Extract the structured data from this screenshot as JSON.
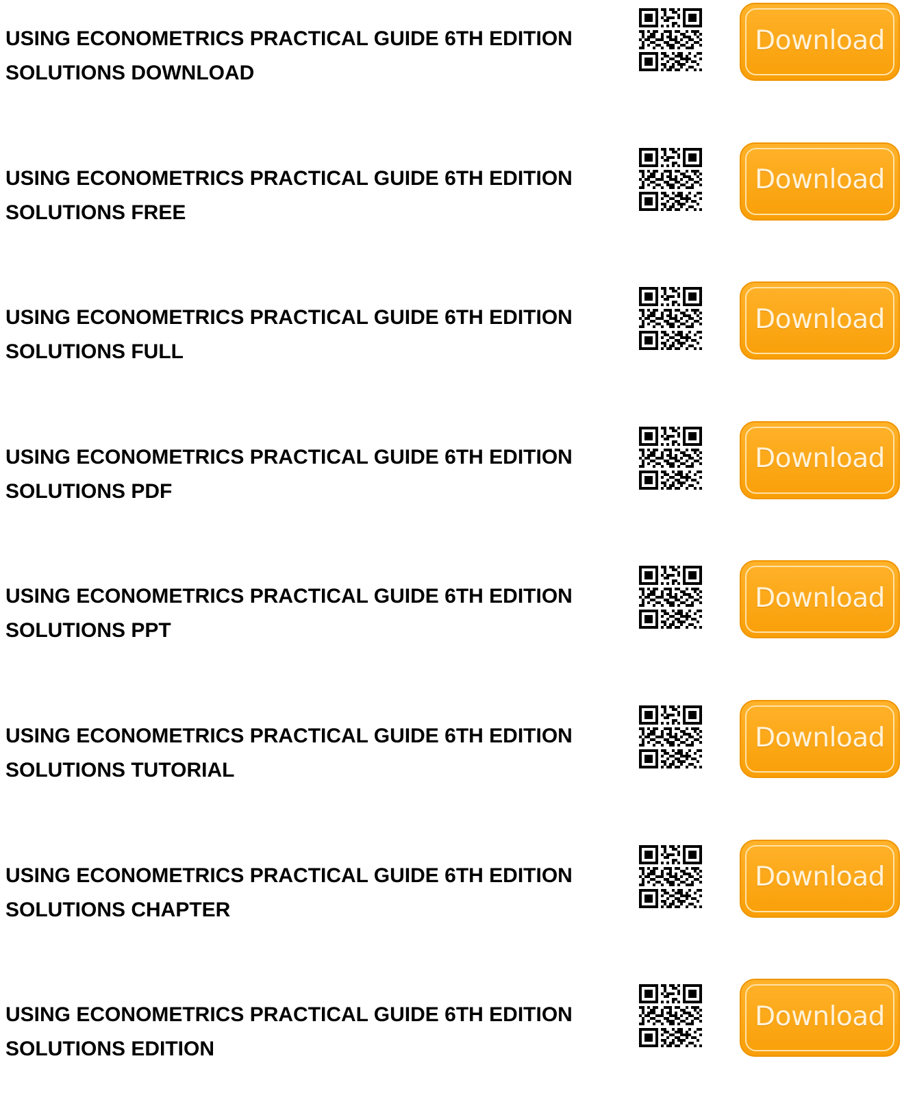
{
  "entries": [
    {
      "line1": "USING ECONOMETRICS PRACTICAL GUIDE 6TH EDITION",
      "line2": "SOLUTIONS DOWNLOAD"
    },
    {
      "line1": "USING ECONOMETRICS PRACTICAL GUIDE 6TH EDITION",
      "line2": "SOLUTIONS FREE"
    },
    {
      "line1": "USING ECONOMETRICS PRACTICAL GUIDE 6TH EDITION",
      "line2": "SOLUTIONS FULL"
    },
    {
      "line1": "USING ECONOMETRICS PRACTICAL GUIDE 6TH EDITION",
      "line2": "SOLUTIONS PDF"
    },
    {
      "line1": "USING ECONOMETRICS PRACTICAL GUIDE 6TH EDITION",
      "line2": "SOLUTIONS PPT"
    },
    {
      "line1": "USING ECONOMETRICS PRACTICAL GUIDE 6TH EDITION",
      "line2": "SOLUTIONS TUTORIAL"
    },
    {
      "line1": "USING ECONOMETRICS PRACTICAL GUIDE 6TH EDITION",
      "line2": "SOLUTIONS CHAPTER"
    },
    {
      "line1": "USING ECONOMETRICS PRACTICAL GUIDE 6TH EDITION",
      "line2": "SOLUTIONS EDITION"
    }
  ],
  "download_label": "Download",
  "icons": {
    "qr": "qr-code-icon"
  },
  "colors": {
    "button_fill": "#fba812",
    "button_border": "#ef9400",
    "button_text": "#fff2d8",
    "title_text": "#000000"
  }
}
